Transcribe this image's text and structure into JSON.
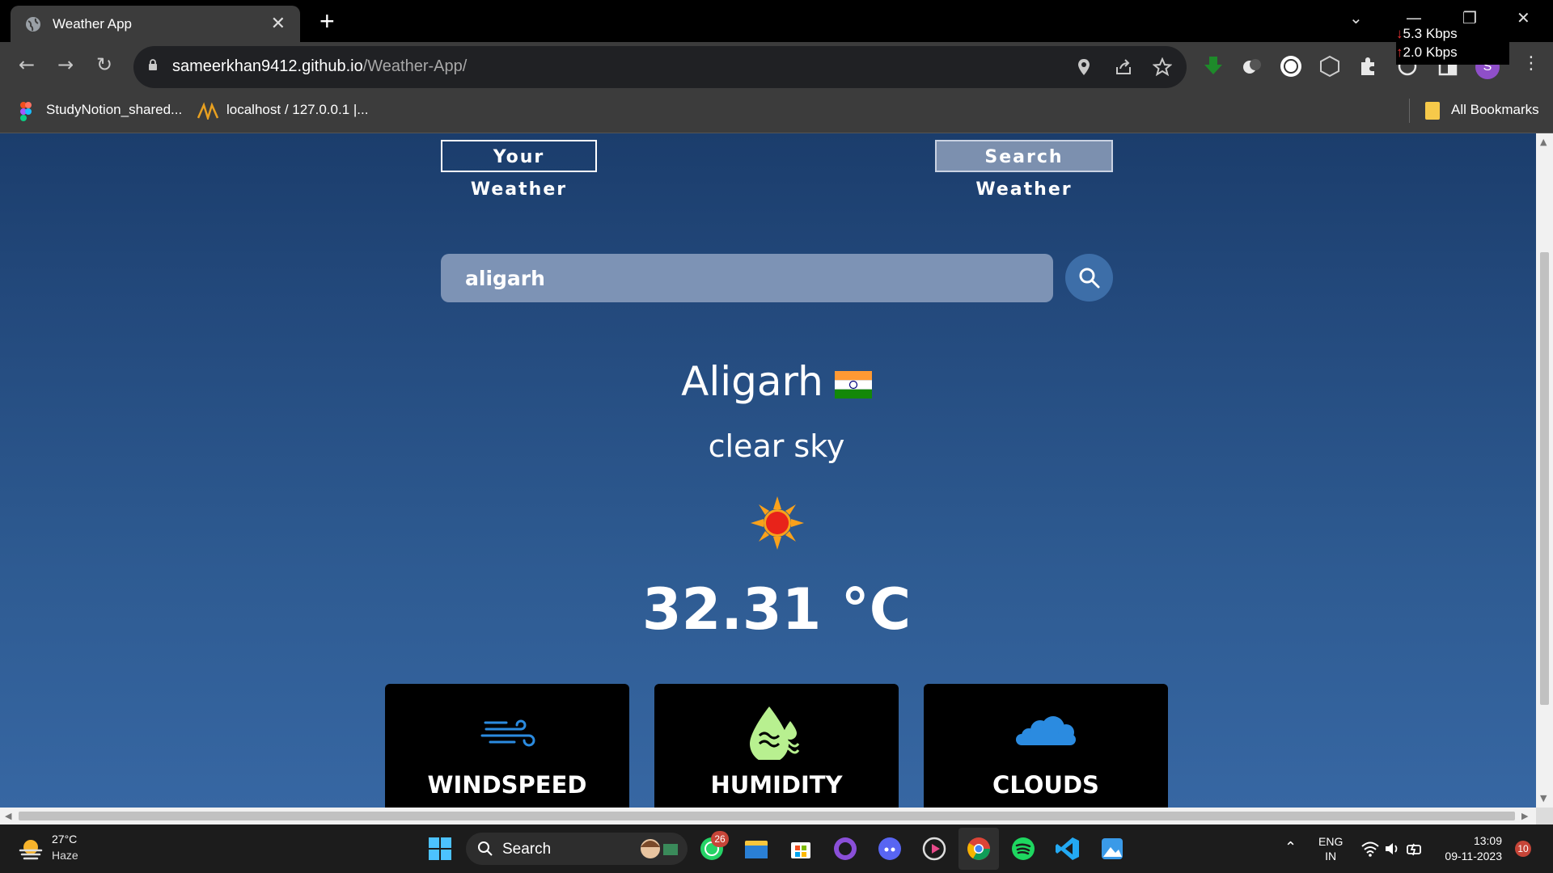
{
  "browser": {
    "tab_title": "Weather App",
    "url_domain": "sameerkhan9412.github.io",
    "url_path": "/Weather-App/",
    "net_down": "5.3 Kbps",
    "net_up": "2.0 Kbps",
    "profile_initial": "S",
    "bookmarks": [
      {
        "label": "StudyNotion_shared..."
      },
      {
        "label": "localhost / 127.0.0.1 |..."
      }
    ],
    "all_bookmarks": "All Bookmarks"
  },
  "app": {
    "tabs": {
      "your_weather": "Your Weather",
      "search_weather": "Search Weather",
      "active": "search_weather"
    },
    "search": {
      "value": "aligarh"
    },
    "city": "Aligarh",
    "description": "clear sky",
    "temperature": "32.31 °C",
    "cards": [
      {
        "label": "WINDSPEED",
        "icon": "wind-icon"
      },
      {
        "label": "HUMIDITY",
        "icon": "humidity-icon"
      },
      {
        "label": "CLOUDS",
        "icon": "cloud-icon"
      }
    ]
  },
  "taskbar": {
    "weather_temp": "27°C",
    "weather_cond": "Haze",
    "search_label": "Search",
    "whatsapp_badge": "26",
    "lang_top": "ENG",
    "lang_bottom": "IN",
    "time": "13:09",
    "date": "09-11-2023",
    "notif_count": "10"
  },
  "colors": {
    "page_top": "#1b3d6c",
    "page_bottom": "#3767a3",
    "search_bg": "#7d93b5",
    "search_button": "#3d6ea8",
    "card_bg": "#000000",
    "icon_blue": "#2b8be0",
    "icon_green": "#b8f090"
  }
}
